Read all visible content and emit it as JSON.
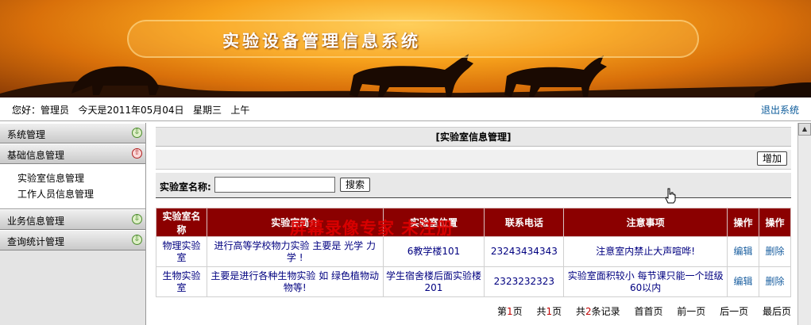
{
  "banner": {
    "title": "实验设备管理信息系统"
  },
  "infobar": {
    "greeting": "您好：管理员   今天是2011年05月04日   星期三   上午",
    "logout": "退出系统"
  },
  "sidebar": {
    "menus": [
      {
        "label": "系统管理"
      },
      {
        "label": "基础信息管理",
        "items": [
          "实验室信息管理",
          "工作人员信息管理"
        ]
      },
      {
        "label": "业务信息管理"
      },
      {
        "label": "查询统计管理"
      }
    ]
  },
  "main": {
    "title": "[实验室信息管理]",
    "add_label": "增加",
    "search_label": "实验室名称:",
    "search_value": "",
    "search_button": "搜索",
    "columns": [
      "实验室名称",
      "实验室简介",
      "实验室位置",
      "联系电话",
      "注意事项",
      "操作",
      "操作"
    ],
    "rows": [
      {
        "name": "物理实验室",
        "intro": "进行高等学校物力实验 主要是 光学 力学 !",
        "location": "6教学楼101",
        "phone": "23243434343",
        "notes": "注意室内禁止大声喧哗!",
        "edit": "编辑",
        "delete": "删除"
      },
      {
        "name": "生物实验室",
        "intro": "主要是进行各种生物实验 如 绿色植物动物等!",
        "location": "学生宿舍楼后面实验楼201",
        "phone": "2323232323",
        "notes": "实验室面积较小 每节课只能一个班级60以内",
        "edit": "编辑",
        "delete": "删除"
      }
    ],
    "pager": {
      "page_prefix": "第",
      "page_num": "1",
      "page_suffix": "页",
      "total_prefix": "共",
      "total_num": "1",
      "total_suffix": "页",
      "records_prefix": "共",
      "records_num": "2",
      "records_suffix": "条记录",
      "first": "首首页",
      "prev": "前一页",
      "next": "后一页",
      "last": "最后页"
    }
  },
  "watermark": "屏幕录像专家 未注册"
}
